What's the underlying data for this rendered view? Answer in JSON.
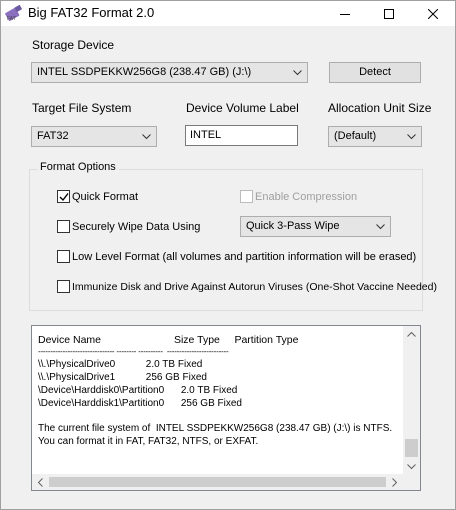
{
  "window": {
    "title": "Big FAT32 Format 2.0",
    "icon": "usb-drive-icon"
  },
  "storage": {
    "label": "Storage Device",
    "selected": "INTEL SSDPEKKW256G8 (238.47 GB) (J:\\)",
    "detect_label": "Detect"
  },
  "target_fs": {
    "label": "Target File System",
    "selected": "FAT32"
  },
  "volume_label": {
    "label": "Device Volume Label",
    "value": "INTEL"
  },
  "alloc_unit": {
    "label": "Allocation Unit Size",
    "selected": "(Default)"
  },
  "format_options": {
    "title": "Format Options",
    "quick_format": {
      "label": "Quick Format",
      "checked": true
    },
    "enable_compression": {
      "label": "Enable Compression",
      "checked": false,
      "enabled": false
    },
    "secure_wipe": {
      "label": "Securely Wipe Data Using",
      "checked": false
    },
    "wipe_method": "Quick 3-Pass Wipe",
    "low_level": {
      "label": "Low Level Format (all volumes and partition information will be erased)",
      "checked": false
    },
    "immunize": {
      "label": "Immunize Disk and Drive Against Autorun Viruses (One-Shot Vaccine Needed)",
      "checked": false
    }
  },
  "output": {
    "header": "Device Name                         Size Type     Partition Type",
    "separator": "------------------------------- -------- ----------  -------------------------",
    "devices": [
      "\\\\.\\PhysicalDrive0           2.0 TB Fixed",
      "\\\\.\\PhysicalDrive1           256 GB Fixed",
      "\\Device\\Harddisk0\\Partition0      2.0 TB Fixed",
      "\\Device\\Harddisk1\\Partition0      256 GB Fixed"
    ],
    "message_line1": "The current file system of  INTEL SSDPEKKW256G8 (238.47 GB) (J:\\) is NTFS.",
    "message_line2": "You can format it in FAT, FAT32, NTFS, or EXFAT."
  }
}
